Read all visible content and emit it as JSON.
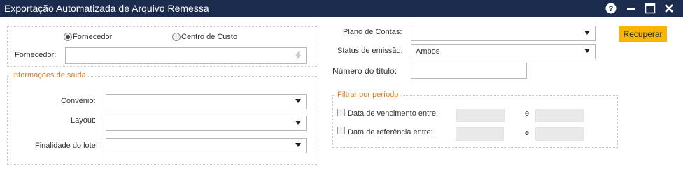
{
  "window": {
    "title": "Exportação Automatizada de Arquivo Remessa",
    "icons": [
      "help-icon",
      "minimize-icon",
      "maximize-icon",
      "close-icon"
    ]
  },
  "left": {
    "radio_fornecedor": "Fornecedor",
    "radio_centro_custo": "Centro de Custo",
    "fornecedor_label": "Fornecedor:",
    "info_legend": "Informações de saída",
    "convenio_label": "Convênio:",
    "layout_label": "Layout:",
    "finalidade_label": "Finalidade do lote:"
  },
  "middle": {
    "plano_label": "Plano de Contas:",
    "status_label": "Status de emissão:",
    "status_value": "Ambos",
    "numero_label": "Número do título:",
    "filter_legend": "Filtrar por período",
    "vencimento_label": "Data de vencimento entre:",
    "referencia_label": "Data de referência entre:",
    "e_label": "e"
  },
  "actions": {
    "recuperar": "Recuperar"
  },
  "colors": {
    "titlebar": "#1b2c4f",
    "accent_orange": "#e07b24",
    "button_yellow": "#f7b500"
  }
}
